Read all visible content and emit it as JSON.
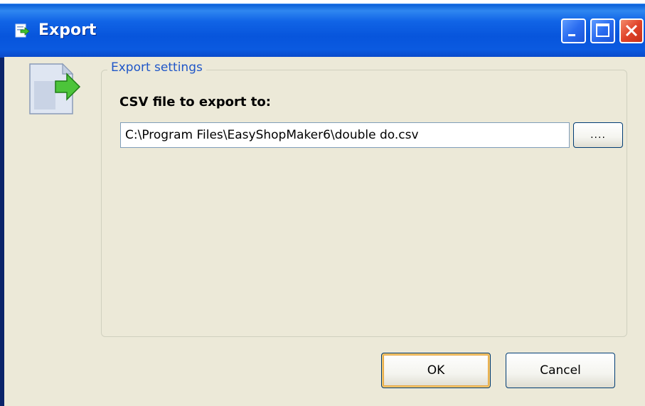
{
  "window": {
    "title": "Export",
    "controls": [
      "minimize",
      "maximize",
      "close"
    ]
  },
  "group": {
    "legend": "Export settings",
    "field_label": "CSV file to export to:",
    "file_path": "C:\\Program Files\\EasyShopMaker6\\double do.csv",
    "browse_label": "...."
  },
  "buttons": {
    "ok_label": "OK",
    "cancel_label": "Cancel"
  },
  "colors": {
    "titlebar": "#0755dc",
    "client": "#ece9d8",
    "legend_text": "#1f56c8",
    "close_button": "#e0442a"
  },
  "icons": {
    "title": "export-icon",
    "dialog": "export-document-icon"
  }
}
